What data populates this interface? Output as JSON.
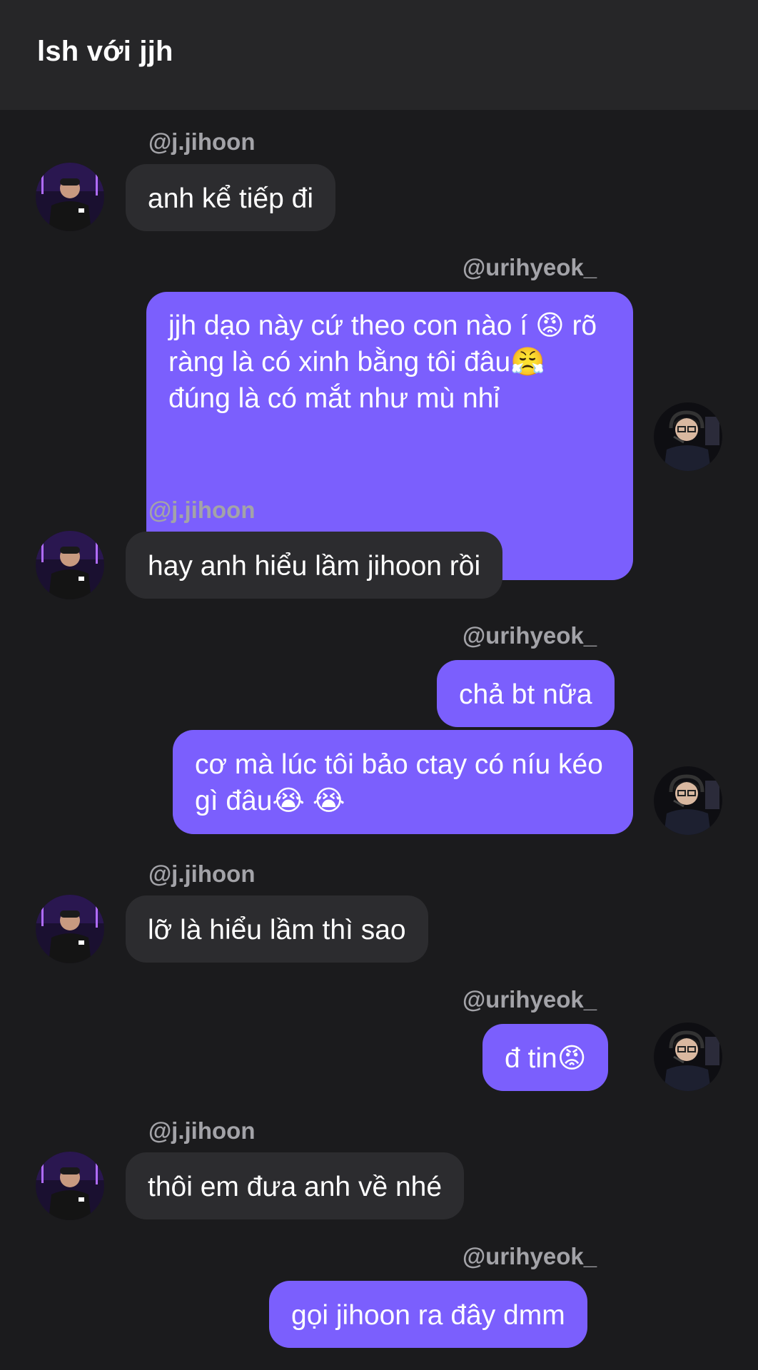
{
  "header": {
    "title": "lsh với jjh"
  },
  "users": {
    "them": "@j.jihoon",
    "me": "@urihyeok_"
  },
  "colors": {
    "incoming_bubble": "#2c2c2f",
    "outgoing_bubble": "#7b5ffd",
    "background": "#1b1b1d",
    "username": "#a3a3a8"
  },
  "messages": [
    {
      "from": "@j.jihoon",
      "text": "anh kể tiếp đi"
    },
    {
      "from": "@urihyeok_",
      "text": "jjh dạo này cứ theo con nào í 😡 rõ ràng là có xinh bằng tôi đâu😤 đúng là có mắt như mù nhỉ"
    },
    {
      "from": "@j.jihoon",
      "text": "hay anh hiểu lầm jihoon rồi"
    },
    {
      "from": "@urihyeok_",
      "text": "chả bt nữa"
    },
    {
      "from": "@urihyeok_",
      "text": "cơ mà lúc tôi bảo ctay có níu kéo gì đâu😭 😭"
    },
    {
      "from": "@j.jihoon",
      "text": "lỡ là hiểu lầm thì sao"
    },
    {
      "from": "@urihyeok_",
      "text": "đ tin😡"
    },
    {
      "from": "@j.jihoon",
      "text": "thôi em đưa anh về nhé"
    },
    {
      "from": "@urihyeok_",
      "text": "gọi jihoon ra đây dmm"
    }
  ]
}
